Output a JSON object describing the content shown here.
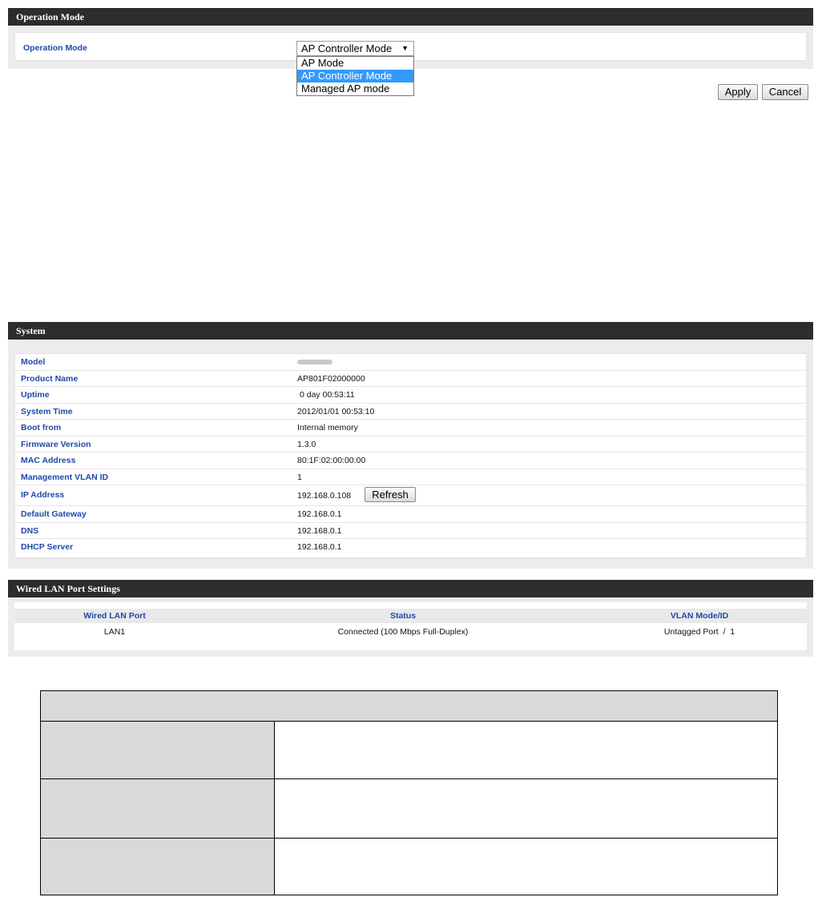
{
  "operation_mode": {
    "header": "Operation Mode",
    "label": "Operation Mode",
    "selected": "AP Controller Mode",
    "options": [
      "AP Mode",
      "AP Controller Mode",
      "Managed AP mode"
    ],
    "apply_label": "Apply",
    "cancel_label": "Cancel"
  },
  "system": {
    "header": "System",
    "rows": [
      {
        "key": "Model",
        "value": ""
      },
      {
        "key": "Product Name",
        "value": "AP801F02000000"
      },
      {
        "key": "Uptime",
        "value": "0 day 00:53:11"
      },
      {
        "key": "System Time",
        "value": "2012/01/01 00:53:10"
      },
      {
        "key": "Boot from",
        "value": "Internal memory"
      },
      {
        "key": "Firmware Version",
        "value": "1.3.0"
      },
      {
        "key": "MAC Address",
        "value": "80:1F:02:00:00:00"
      },
      {
        "key": "Management VLAN ID",
        "value": "1"
      },
      {
        "key": "IP Address",
        "value": "192.168.0.108"
      },
      {
        "key": "Default Gateway",
        "value": "192.168.0.1"
      },
      {
        "key": "DNS",
        "value": "192.168.0.1"
      },
      {
        "key": "DHCP Server",
        "value": "192.168.0.1"
      }
    ],
    "refresh_label": "Refresh"
  },
  "wired": {
    "header": "Wired LAN Port Settings",
    "columns": [
      "Wired LAN Port",
      "Status",
      "VLAN Mode/ID"
    ],
    "row": {
      "port": "LAN1",
      "status": "Connected (100 Mbps Full-Duplex)",
      "vlan": "Untagged Port  /  1"
    }
  }
}
